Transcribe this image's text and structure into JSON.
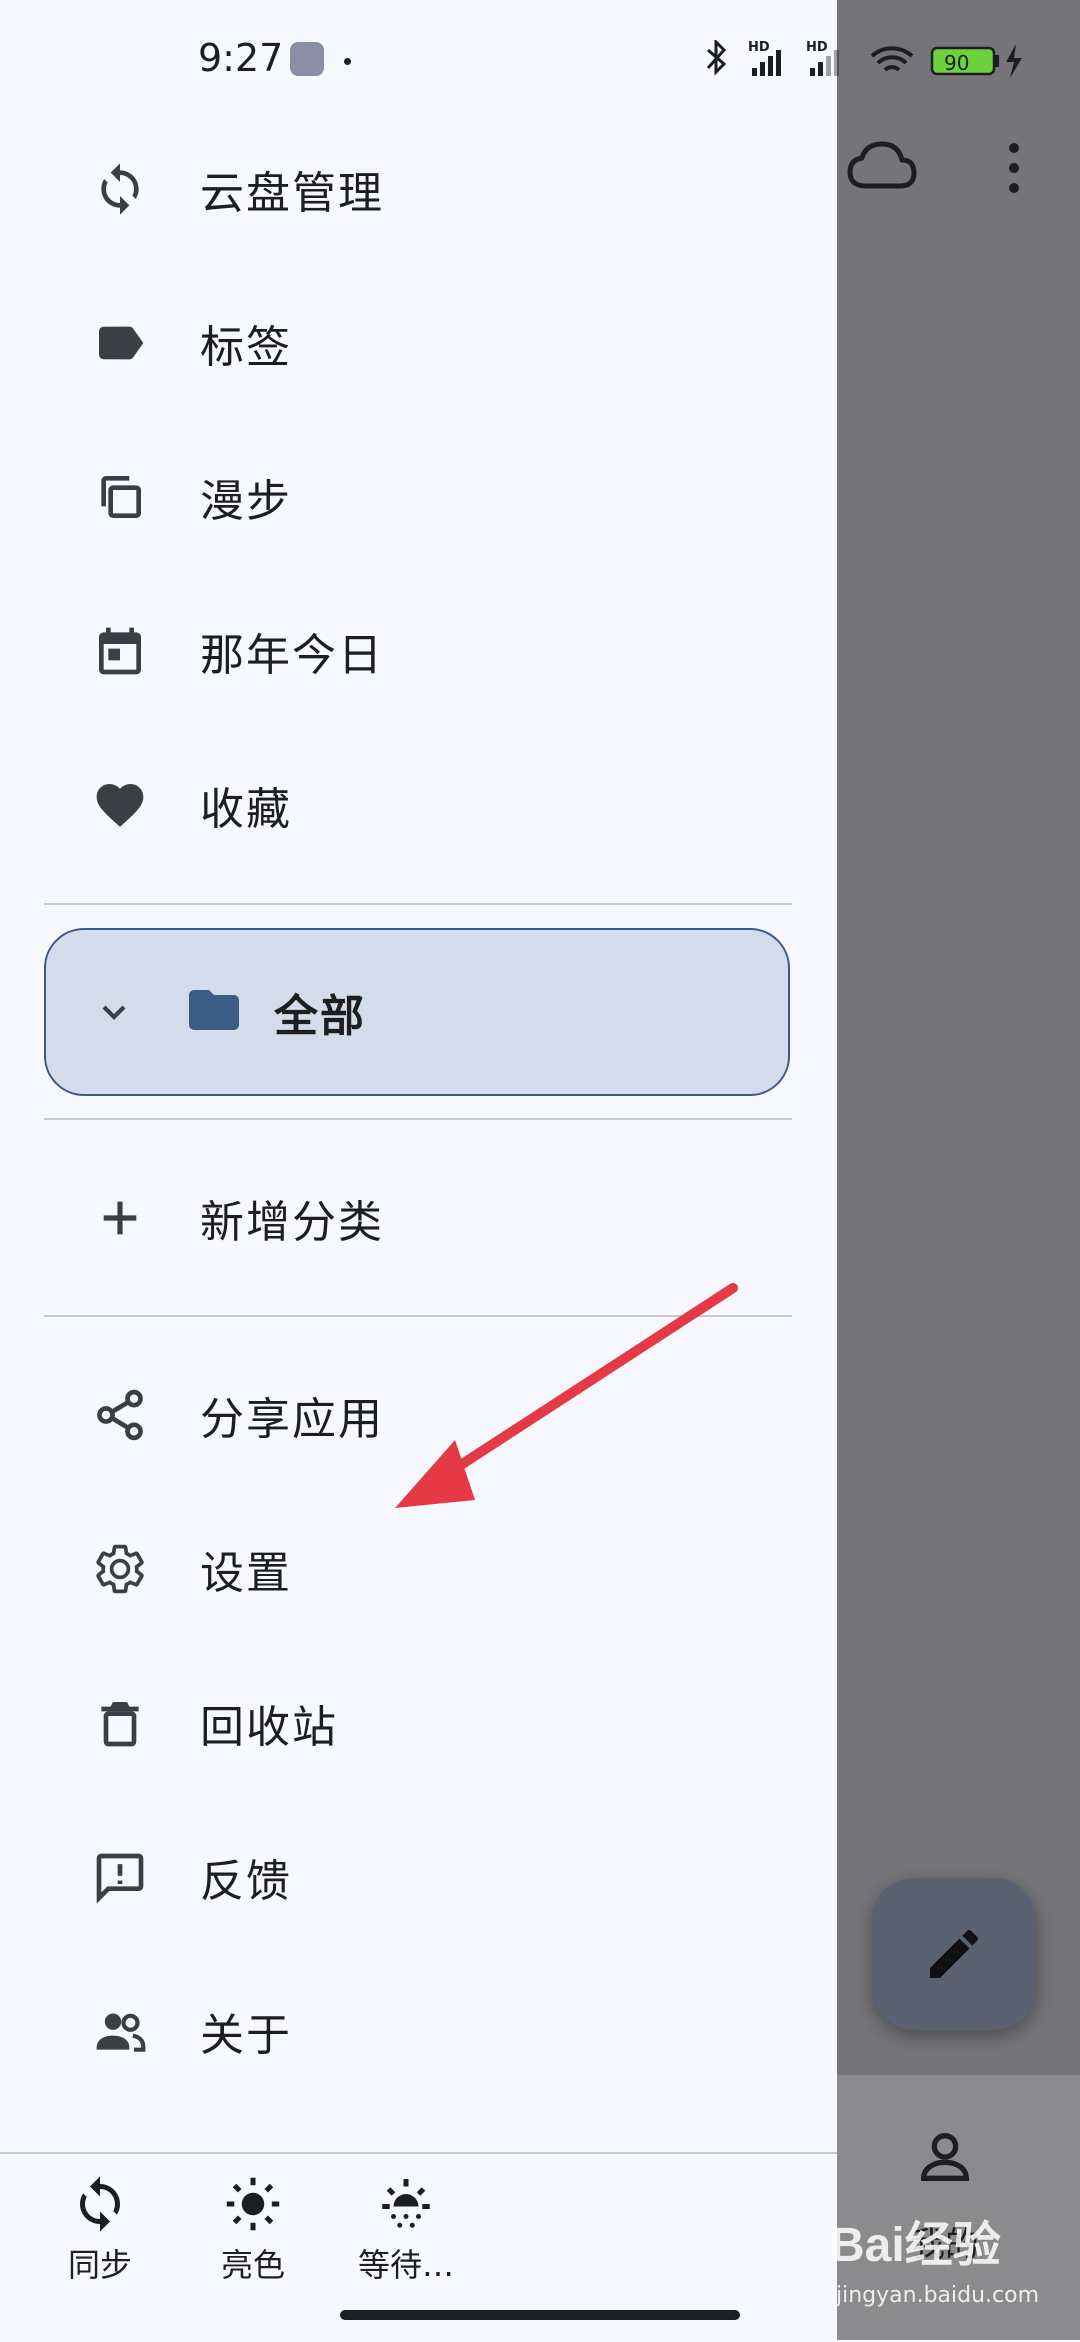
{
  "status_bar": {
    "time": "9:27",
    "battery": "90",
    "network_label": "HD"
  },
  "drawer": {
    "items": [
      {
        "label": "云盘管理",
        "icon": "sync-icon"
      },
      {
        "label": "标签",
        "icon": "label-icon"
      },
      {
        "label": "漫步",
        "icon": "copy-icon"
      },
      {
        "label": "那年今日",
        "icon": "calendar-icon"
      },
      {
        "label": "收藏",
        "icon": "heart-icon"
      }
    ],
    "folder": {
      "label": "全部",
      "icon": "folder-icon",
      "expanded": true
    },
    "add_category": {
      "label": "新增分类",
      "icon": "plus-icon"
    },
    "more_items": [
      {
        "label": "分享应用",
        "icon": "share-icon"
      },
      {
        "label": "设置",
        "icon": "gear-icon"
      },
      {
        "label": "回收站",
        "icon": "trash-icon"
      },
      {
        "label": "反馈",
        "icon": "feedback-icon"
      },
      {
        "label": "关于",
        "icon": "people-icon"
      }
    ]
  },
  "bottom_bar": {
    "sync": "同步",
    "theme": "亮色",
    "auto": "等待…"
  },
  "background_app": {
    "mine_label": "我的"
  },
  "watermark": {
    "brand": "Bai经验",
    "url": "jingyan.baidu.com"
  },
  "colors": {
    "accent": "#3d5c85",
    "folder_highlight": "#d3dcea",
    "annotation_arrow": "#e63946",
    "scrim": "#757578"
  }
}
